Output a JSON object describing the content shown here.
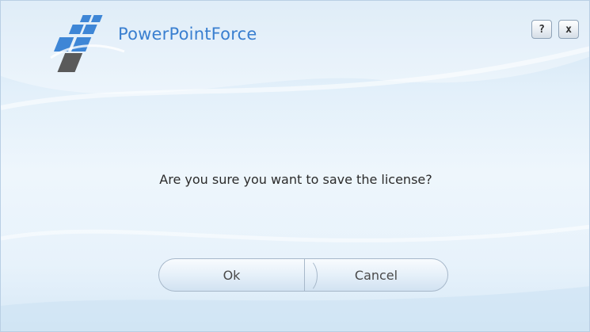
{
  "header": {
    "brand_text": "PowerPointForce",
    "logo_icon": "grid-cube-logo",
    "help_label": "?",
    "close_label": "x"
  },
  "dialog": {
    "message": "Are you sure you want to save the license?",
    "ok_label": "Ok",
    "cancel_label": "Cancel"
  },
  "colors": {
    "brand": "#3a7fd0",
    "logo_blue": "#3e86d6",
    "logo_dark": "#5a5a5a",
    "background_light": "#eef6fc",
    "background_top": "#cfe3f4"
  }
}
